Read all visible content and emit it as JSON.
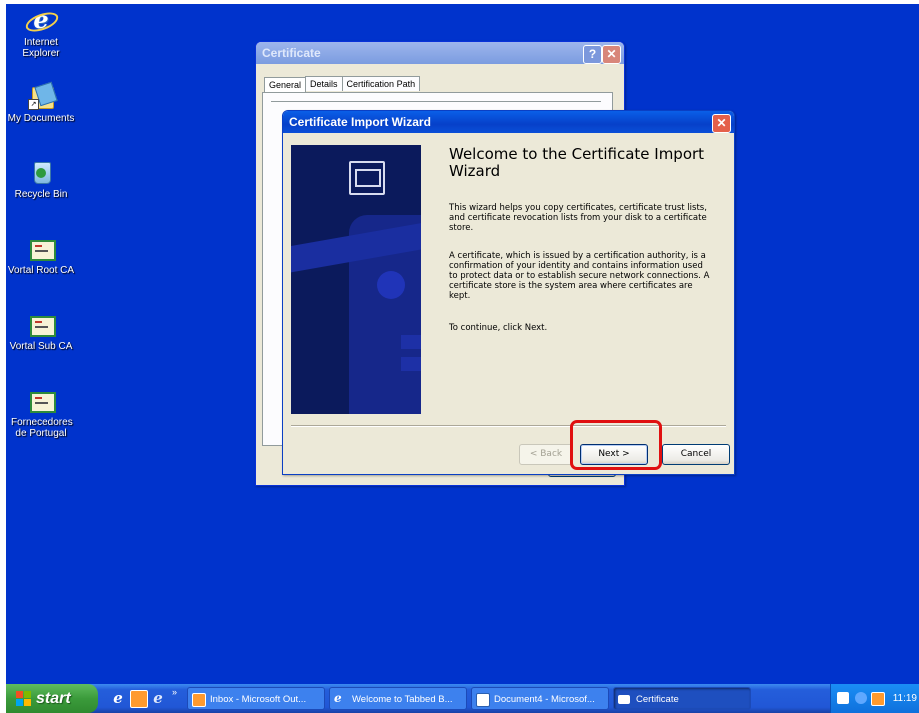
{
  "desktop": {
    "icons": [
      {
        "label": "Internet Explorer",
        "icon": "internet-explorer-icon"
      },
      {
        "label": "My Documents",
        "icon": "my-documents-icon"
      },
      {
        "label": "Recycle Bin",
        "icon": "recycle-bin-icon"
      },
      {
        "label": "Vortal Root CA",
        "icon": "certificate-icon"
      },
      {
        "label": "Vortal Sub CA",
        "icon": "certificate-icon"
      },
      {
        "label": "Fornecedores de Portugal",
        "icon": "certificate-icon"
      }
    ]
  },
  "certificate_window": {
    "title": "Certificate",
    "help_glyph": "?",
    "close_glyph": "✕",
    "tabs": [
      "General",
      "Details",
      "Certification Path"
    ]
  },
  "wizard": {
    "title": "Certificate Import Wizard",
    "close_glyph": "✕",
    "heading": "Welcome to the Certificate Import Wizard",
    "paragraphs": [
      "This wizard helps you copy certificates, certificate trust lists, and certificate revocation lists from your disk to a certificate store.",
      "A certificate, which is issued by a certification authority, is a confirmation of your identity and contains information used to protect data or to establish secure network connections. A certificate store is the system area where certificates are kept.",
      "To continue, click Next."
    ],
    "buttons": {
      "back": "< Back",
      "next": "Next >",
      "cancel": "Cancel"
    }
  },
  "taskbar": {
    "start_label": "start",
    "chevron": "»",
    "tasks": [
      {
        "label": "Inbox - Microsoft Out...",
        "icon": "outlook-icon"
      },
      {
        "label": "Welcome to Tabbed B...",
        "icon": "internet-explorer-icon"
      },
      {
        "label": "Document4 - Microsof...",
        "icon": "word-icon"
      },
      {
        "label": "Certificate",
        "icon": "window-icon"
      }
    ],
    "clock": "11:19"
  },
  "colors": {
    "desktop": "#0033cc",
    "highlight": "#e01010",
    "titlebar_active": "#0a5fe8"
  }
}
